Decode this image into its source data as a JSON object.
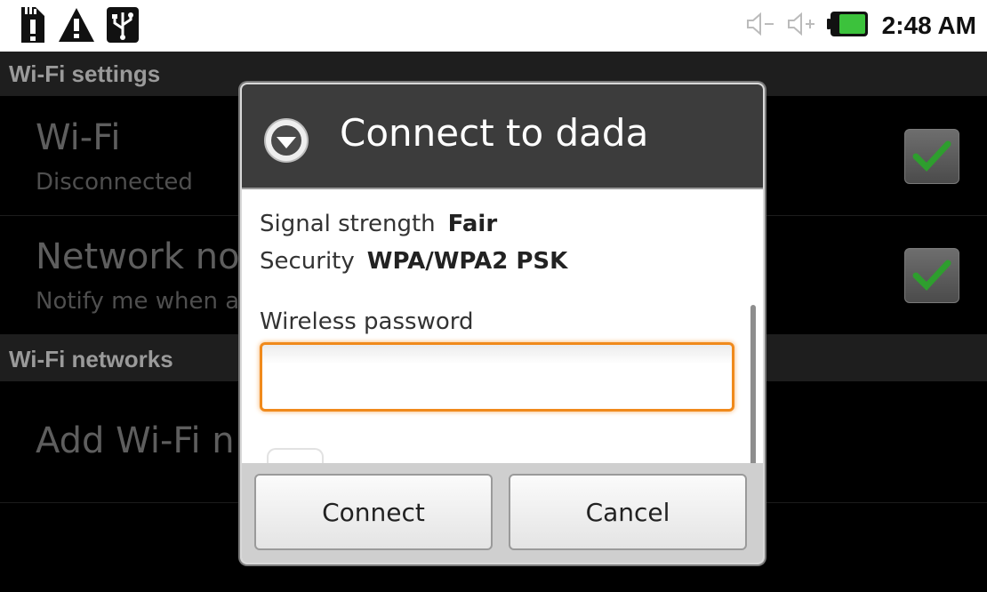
{
  "status_bar": {
    "left_icons": [
      "sd-card-alert-icon",
      "warning-icon",
      "usb-icon"
    ],
    "right_icons": [
      "volume-down-icon",
      "volume-up-icon",
      "battery-icon"
    ],
    "time": "2:48 AM"
  },
  "settings": {
    "header_wifi_settings": "Wi-Fi settings",
    "wifi": {
      "title": "Wi-Fi",
      "subtitle": "Disconnected",
      "checked": true
    },
    "network_notification": {
      "title": "Network no",
      "subtitle": "Notify me when a",
      "checked": true
    },
    "header_wifi_networks": "Wi-Fi networks",
    "add_network": {
      "title": "Add Wi-Fi n"
    }
  },
  "dialog": {
    "title": "Connect to dada",
    "icon": "wifi-signal-icon",
    "signal_label": "Signal strength",
    "signal_value": "Fair",
    "security_label": "Security",
    "security_value": "WPA/WPA2 PSK",
    "password_label": "Wireless password",
    "password_value": "",
    "connect_label": "Connect",
    "cancel_label": "Cancel"
  },
  "colors": {
    "accent_focus": "#f08a1c",
    "check_green": "#2e9e2e",
    "battery_green": "#3cc23c"
  }
}
